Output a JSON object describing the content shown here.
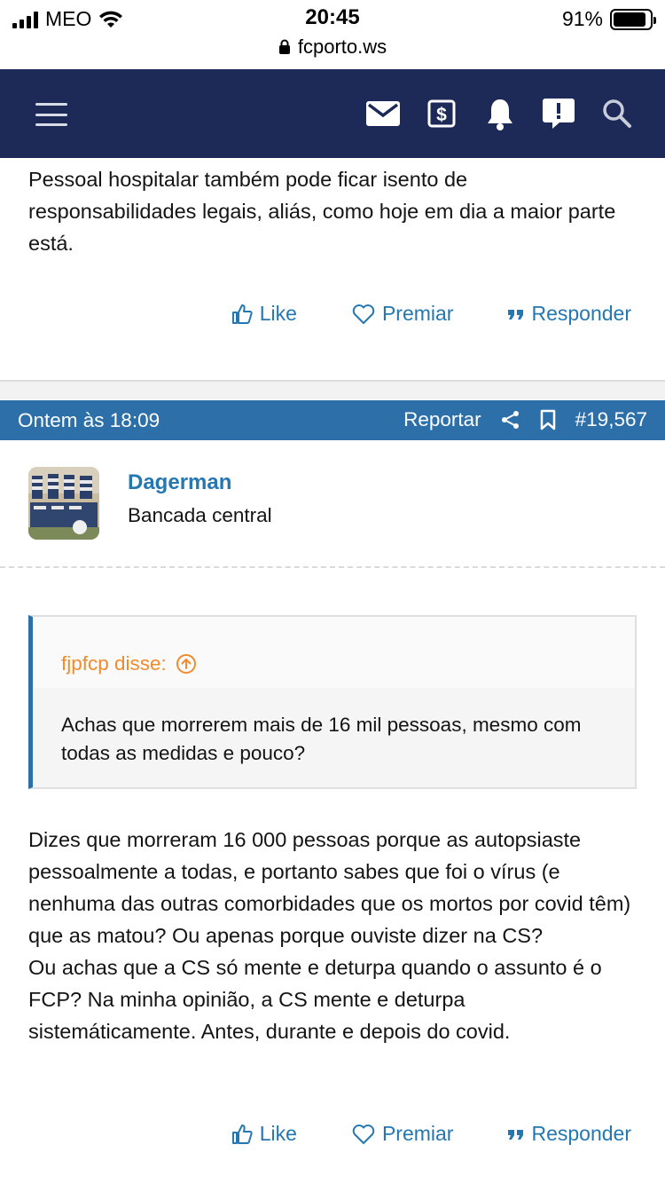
{
  "status_bar": {
    "carrier": "MEO",
    "time": "20:45",
    "battery": "91%",
    "battery_level": 0.91,
    "url": "fcporto.ws"
  },
  "header": {
    "icons": [
      "menu-icon",
      "mail-icon",
      "dollar-icon",
      "bell-icon",
      "alert-icon",
      "search-icon"
    ],
    "background": "#1d2a57"
  },
  "post_prev": {
    "text": "Pessoal hospitalar também pode ficar isento de responsabilidades legais, aliás, como hoje em dia a maior parte está.",
    "actions": {
      "like": "Like",
      "award": "Premiar",
      "reply": "Responder"
    }
  },
  "post": {
    "date": "Ontem às 18:09",
    "report": "Reportar",
    "number": "#19,567",
    "author": "Dagerman",
    "author_title": "Bancada central",
    "quote_author": "fjpfcp disse:",
    "quote_text": "Achas que morrerem mais de 16 mil pessoas, mesmo com todas as medidas e pouco?",
    "body_line1": "Dizes que morreram 16 000 pessoas porque as autopsiaste pessoalmente a todas, e portanto sabes que foi o vírus (e nenhuma das outras comorbidades que os mortos por covid têm) que as matou? Ou apenas porque ouviste dizer na CS?",
    "body_line2": "Ou achas que a CS só mente e deturpa quando o assunto é o FCP? Na minha opinião, a CS mente e deturpa sistemáticamente. Antes, durante e depois do covid.",
    "actions": {
      "like": "Like",
      "award": "Premiar",
      "reply": "Responder"
    }
  },
  "colors": {
    "link": "#2577b1",
    "post_bar": "#2d70a9",
    "quote_author": "#f08b2e"
  }
}
